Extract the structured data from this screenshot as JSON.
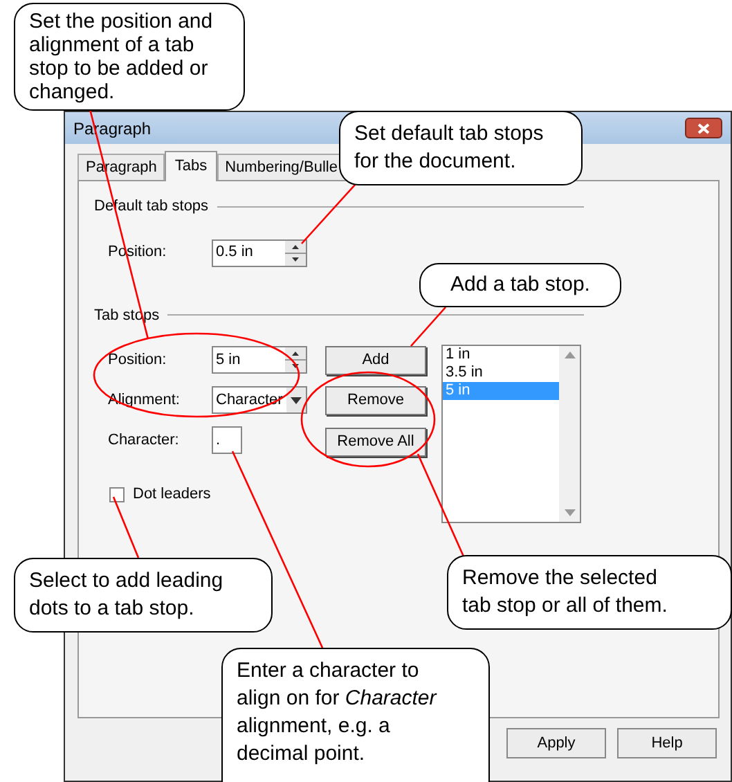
{
  "dialog": {
    "title": "Paragraph",
    "tabs": [
      {
        "label": "Paragraph",
        "selected": false
      },
      {
        "label": "Tabs",
        "selected": true
      },
      {
        "label": "Numbering/Bulle",
        "selected": false
      }
    ],
    "default_tab_stops": {
      "heading": "Default tab stops",
      "position_label": "Position:",
      "position_value": "0.5 in"
    },
    "tab_stops": {
      "heading": "Tab stops",
      "position_label": "Position:",
      "position_value": "5 in",
      "alignment_label": "Alignment:",
      "alignment_value": "Character",
      "character_label": "Character:",
      "character_value": ".",
      "add_button": "Add",
      "remove_button": "Remove",
      "remove_all_button": "Remove All",
      "list": [
        {
          "text": "1 in",
          "selected": false
        },
        {
          "text": "3.5 in",
          "selected": false
        },
        {
          "text": "5 in",
          "selected": true
        }
      ]
    },
    "dot_leaders": {
      "label": "Dot leaders",
      "checked": false
    },
    "buttons": [
      "Apply",
      "Help"
    ]
  },
  "callouts": [
    {
      "text": "Set the position and alignment of a tab stop to be added or changed."
    },
    {
      "text": "Set default tab stops for the document."
    },
    {
      "text": "Add a tab stop."
    },
    {
      "text": "Select to add leading dots to a tab stop."
    },
    {
      "text": "Remove the selected tab stop or all of them."
    },
    {
      "text": "Enter a character to align on for *Character* alignment, e.g. a decimal point."
    }
  ]
}
